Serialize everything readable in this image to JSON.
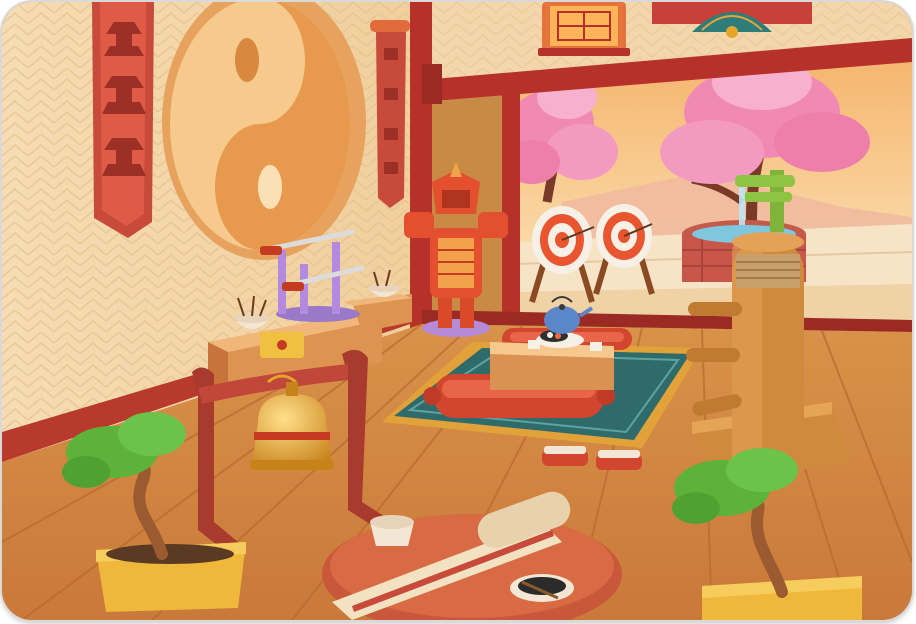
{
  "scene": {
    "room": "dojo-interior",
    "palette": {
      "wall": "#f3d9b0",
      "wall_pattern": "#e7c48f",
      "beam": "#b5312a",
      "floor": "#d88e45",
      "floor_line": "#a9612a",
      "sky_top": "#f7c27a",
      "sky_bottom": "#fbe6b8",
      "blossom": "#f08ab4",
      "rug": "#2f6b6a",
      "cushion": "#d2452e",
      "gold": "#e3a62a",
      "bonsai_leaf": "#5db33a",
      "wood_dummy": "#d08a3d"
    },
    "objects": [
      "yin-yang-wall-decor",
      "pagoda-wall-scroll",
      "small-wall-scroll",
      "hanging-lantern",
      "folding-fan",
      "samurai-armor",
      "katana-rack",
      "incense-bowl",
      "gong-stand",
      "archery-target",
      "bamboo-fountain",
      "cherry-blossom-tree",
      "tea-table",
      "floor-cushion",
      "geta-sandals",
      "wooden-training-dummy",
      "bonsai-tree",
      "scroll-table",
      "ink-bowl"
    ]
  }
}
